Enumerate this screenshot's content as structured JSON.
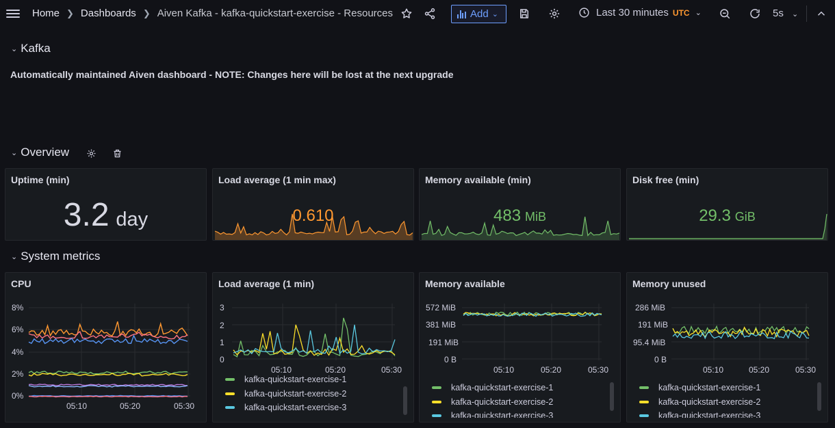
{
  "breadcrumb": {
    "home": "Home",
    "dashboards": "Dashboards",
    "current": "Aiven Kafka - kafka-quickstart-exercise - Resources"
  },
  "toolbar": {
    "add_label": "Add",
    "time_range": "Last 30 minutes",
    "timezone": "UTC",
    "refresh_interval": "5s"
  },
  "rows": {
    "kafka": "Kafka",
    "overview": "Overview",
    "system_metrics": "System metrics"
  },
  "description": "Automatically maintained Aiven dashboard - NOTE: Changes here will be lost at the next upgrade",
  "colors": {
    "background": "#111217",
    "panel": "#181b1f",
    "green": "#73bf69",
    "orange": "#ff9830",
    "blue": "#5794f2",
    "series1": "#73bf69",
    "series2": "#fade2a",
    "series3": "#5ac8e0",
    "accent": "#6e9fff"
  },
  "stats": [
    {
      "title": "Uptime (min)",
      "value": "3.2",
      "unit": "day",
      "color": "#d8d9e3"
    },
    {
      "title": "Load average (1 min max)",
      "value": "0.610",
      "unit": "",
      "color": "#ff9830"
    },
    {
      "title": "Memory available (min)",
      "value": "483",
      "unit": "MiB",
      "color": "#73bf69"
    },
    {
      "title": "Disk free (min)",
      "value": "29.3",
      "unit": "GiB",
      "color": "#73bf69"
    }
  ],
  "graphs": {
    "cpu": {
      "title": "CPU",
      "y_ticks": [
        "8%",
        "6%",
        "4%",
        "2%",
        "0%"
      ],
      "x_ticks": [
        "05:10",
        "05:20",
        "05:30"
      ]
    },
    "load": {
      "title": "Load average (1 min)",
      "y_ticks": [
        "3",
        "2",
        "1",
        "0"
      ],
      "x_ticks": [
        "05:10",
        "05:20",
        "05:30"
      ],
      "legend": [
        "kafka-quickstart-exercise-1",
        "kafka-quickstart-exercise-2",
        "kafka-quickstart-exercise-3"
      ]
    },
    "mem_available": {
      "title": "Memory available",
      "y_ticks": [
        "572 MiB",
        "381 MiB",
        "191 MiB",
        "0 B"
      ],
      "x_ticks": [
        "05:10",
        "05:20",
        "05:30"
      ],
      "legend": [
        "kafka-quickstart-exercise-1",
        "kafka-quickstart-exercise-2",
        "kafka-quickstart-exercise-3"
      ]
    },
    "mem_unused": {
      "title": "Memory unused",
      "y_ticks": [
        "286 MiB",
        "191 MiB",
        "95.4 MiB",
        "0 B"
      ],
      "x_ticks": [
        "05:10",
        "05:20",
        "05:30"
      ],
      "legend": [
        "kafka-quickstart-exercise-1",
        "kafka-quickstart-exercise-2",
        "kafka-quickstart-exercise-3"
      ]
    }
  }
}
